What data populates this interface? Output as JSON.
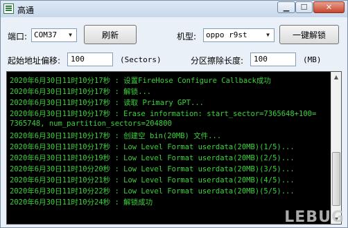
{
  "window": {
    "title": "高通"
  },
  "controls": {
    "port_label": "端口:",
    "port_value": "COM37",
    "refresh_button": "刷新",
    "model_label": "机型:",
    "model_value": "oppo r9st",
    "unlock_button": "一键解锁",
    "start_offset_label": "起始地址偏移:",
    "start_offset_value": "100",
    "start_offset_unit": "(Sectors)",
    "erase_length_label": "分区擦除长度:",
    "erase_length_value": "100",
    "erase_length_unit": "(MB)"
  },
  "log": [
    "2020年6月30日11时10分17秒 : 设置FireHose Configure Callback成功",
    "2020年6月30日11时10分17秒 : 解锁...",
    "2020年6月30日11时10分17秒 : 读取 Primary GPT...",
    "2020年6月30日11时10分17秒 : Erase information: start_sector=7365648+100=",
    "7365748, num_partition_sectors=204800",
    "2020年6月30日11时10分17秒 : 创建空 bin(20MB) 文件...",
    "2020年6月30日11时10分17秒 : Low Level Format userdata(20MB)(1/5)...",
    "2020年6月30日11时10分19秒 : Low Level Format userdata(20MB)(2/5)...",
    "2020年6月30日11时10分20秒 : Low Level Format userdata(20MB)(3/5)...",
    "2020年6月30日11时10分21秒 : Low Level Format userdata(20MB)(4/5)...",
    "2020年6月30日11时10分22秒 : Low Level Format userdata(20MB)(5/5)...",
    "2020年6月30日11时10分24秒 : 解锁成功"
  ],
  "watermark": "LEBUG",
  "icons": {
    "app": "app-icon",
    "minimize": "minimize-icon",
    "maximize": "maximize-icon",
    "close": "close-icon"
  },
  "colors": {
    "log_text": "#39d23a",
    "console_bg": "#000000"
  }
}
